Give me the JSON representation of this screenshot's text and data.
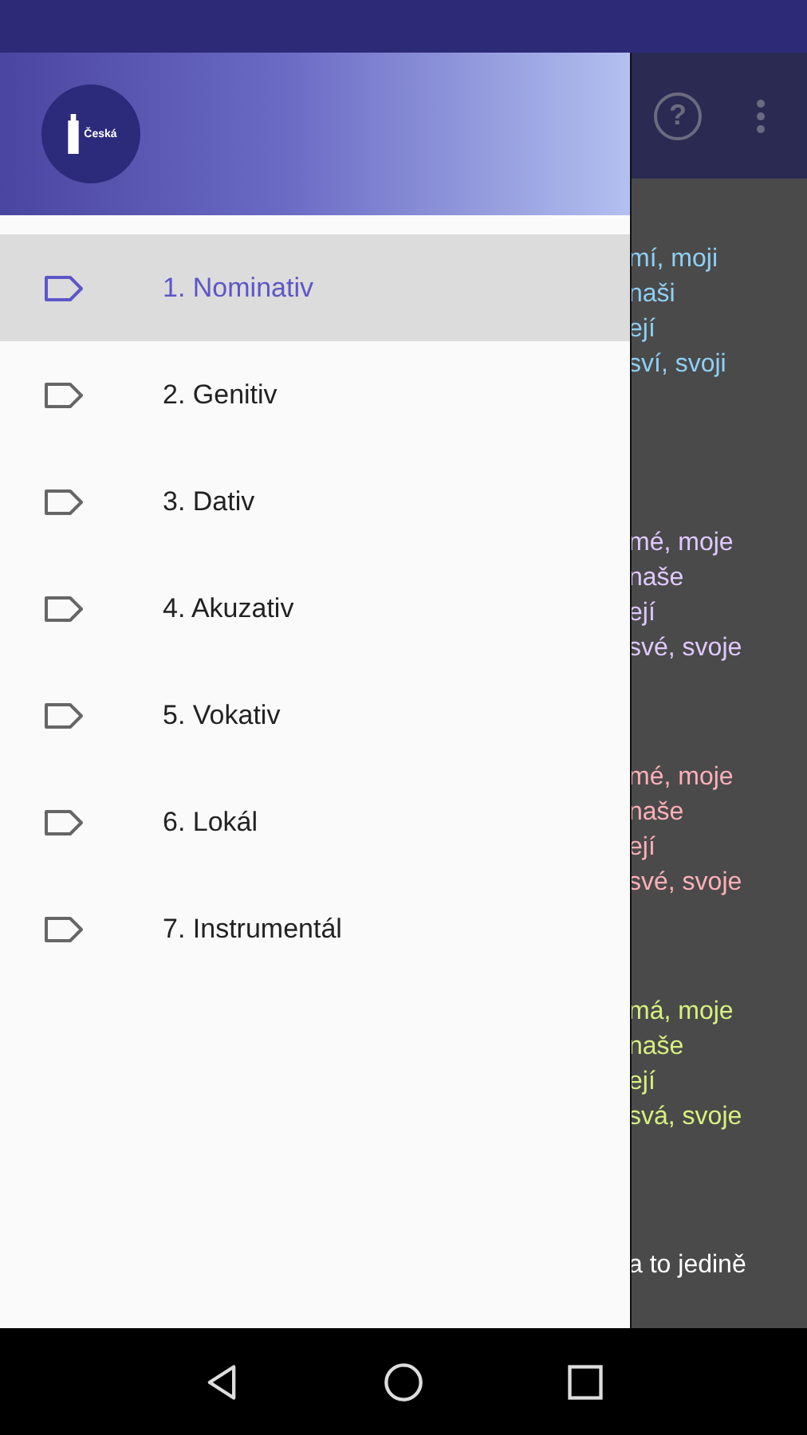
{
  "app_bar": {
    "help": "?"
  },
  "content": {
    "groups": [
      {
        "color": "#8fd0f5",
        "lines": [
          "mí, moji",
          "naši",
          "ejí",
          "sví, svoji"
        ]
      },
      {
        "color": "#e0c8ff",
        "lines": [
          "mé, moje",
          "naše",
          "ejí",
          "své, svoje"
        ]
      },
      {
        "color": "#ffb0b8",
        "lines": [
          "mé, moje",
          "naše",
          "ejí",
          "své, svoje"
        ]
      },
      {
        "color": "#d8f080",
        "lines": [
          "má, moje",
          "naše",
          "ejí",
          "svá, svoje"
        ]
      }
    ],
    "footer": "a to jedině"
  },
  "drawer": {
    "logo_text": "Česká",
    "items": [
      {
        "label": "1. Nominativ",
        "selected": true
      },
      {
        "label": "2. Genitiv",
        "selected": false
      },
      {
        "label": "3. Dativ",
        "selected": false
      },
      {
        "label": "4. Akuzativ",
        "selected": false
      },
      {
        "label": "5. Vokativ",
        "selected": false
      },
      {
        "label": "6. Lokál",
        "selected": false
      },
      {
        "label": "7. Instrumentál",
        "selected": false
      }
    ]
  }
}
